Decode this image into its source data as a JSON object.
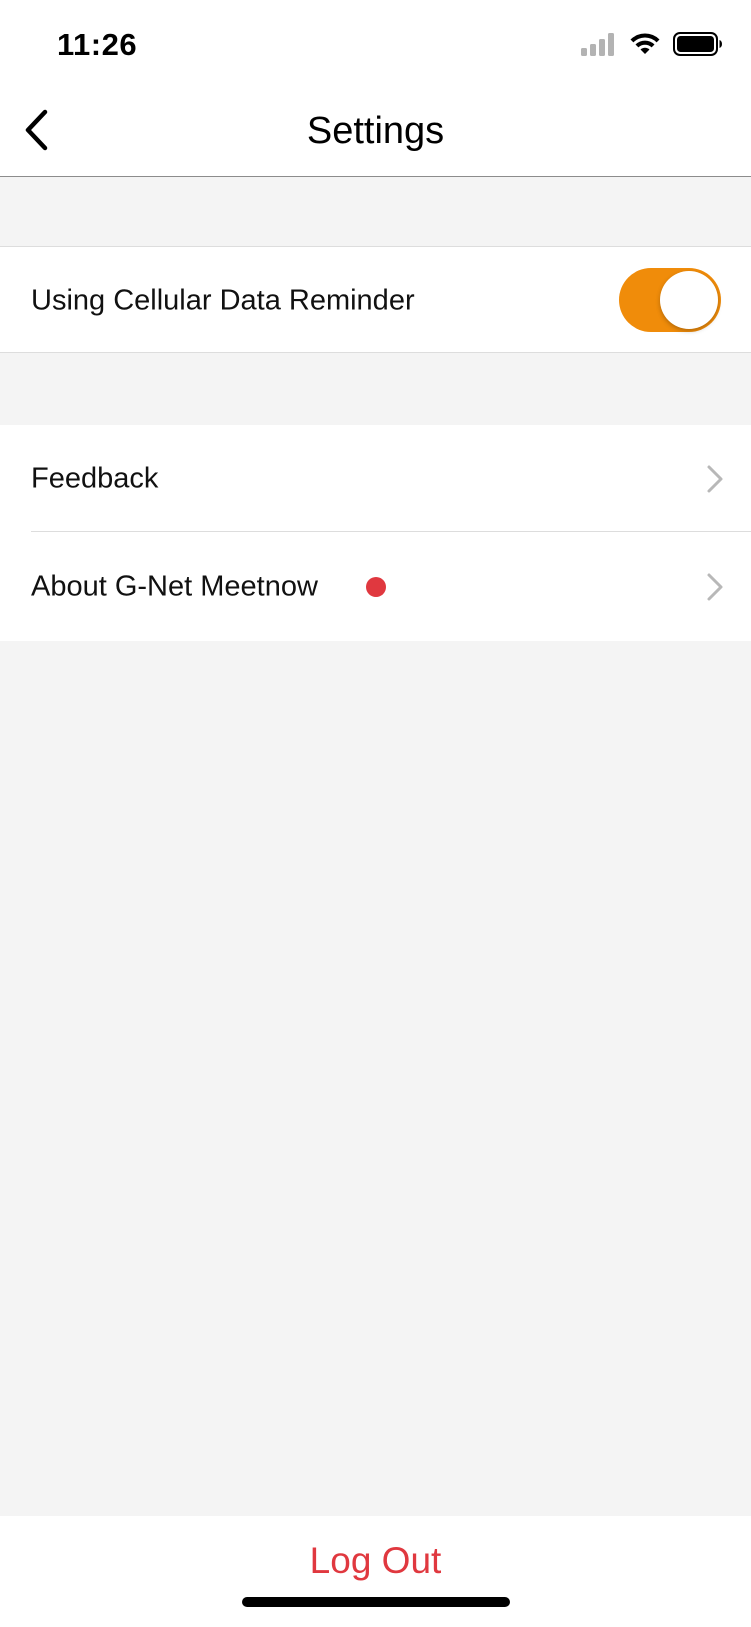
{
  "status_bar": {
    "time": "11:26",
    "icons": [
      "cellular-signal-icon",
      "wifi-icon",
      "battery-icon"
    ]
  },
  "nav": {
    "title": "Settings",
    "back_icon": "chevron-left-icon"
  },
  "settings": {
    "cellular_reminder": {
      "label": "Using Cellular Data Reminder",
      "enabled": true
    },
    "feedback": {
      "label": "Feedback",
      "icon": "chevron-right-icon"
    },
    "about": {
      "label": "About G-Net Meetnow",
      "has_badge": true,
      "icon": "chevron-right-icon"
    }
  },
  "footer": {
    "logout_label": "Log Out"
  },
  "colors": {
    "accent_orange": "#f08c0a",
    "danger_red": "#e0383f",
    "background": "#f4f4f4",
    "chevron_gray": "#b8b8b8"
  }
}
